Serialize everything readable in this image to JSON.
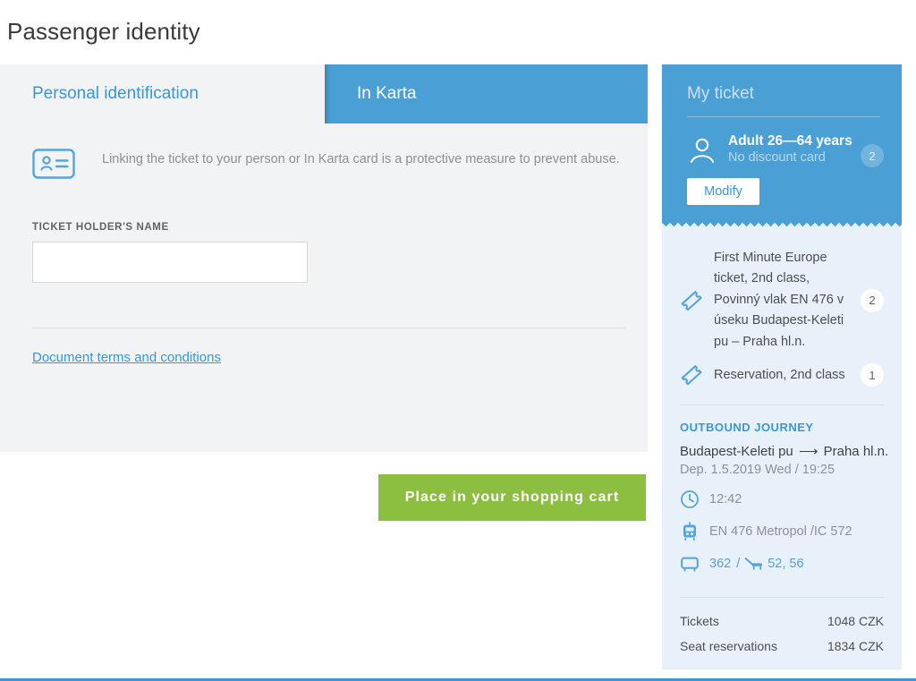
{
  "page": {
    "title": "Passenger identity"
  },
  "tabs": [
    {
      "label": "Personal identification",
      "active": false
    },
    {
      "label": "In Karta",
      "active": true
    }
  ],
  "form": {
    "notice_icon": "id-card-icon",
    "notice": "Linking the ticket to your person or In Karta card is a protective measure to prevent abuse.",
    "name_label": "TICKET HOLDER'S NAME",
    "name_value": "",
    "name_placeholder": "",
    "terms_link": "Document terms and conditions",
    "submit_label": "Place in your shopping cart",
    "submit_color": "#8cbf3f"
  },
  "sidebar": {
    "title": "My ticket",
    "passenger": {
      "icon": "person-icon",
      "title": "Adult 26—64 years",
      "subtitle": "No discount card",
      "quantity": "2",
      "modify_label": "Modify"
    },
    "items": [
      {
        "icon": "ticket-icon",
        "text": "First Minute Europe ticket, 2nd class, Povinný vlak EN 476 v úseku Budapest-Keleti pu – Praha hl.n.",
        "quantity": "2"
      },
      {
        "icon": "ticket-icon",
        "text": "Reservation, 2nd class",
        "quantity": "1"
      }
    ],
    "journey": {
      "heading": "OUTBOUND JOURNEY",
      "from": "Budapest-Keleti pu",
      "arrow": "⟶",
      "to": "Praha hl.n.",
      "departure": "Dep. 1.5.2019 Wed / 19:25",
      "duration_icon": "clock-icon",
      "duration": "12:42",
      "train_icon": "train-icon",
      "train": "EN 476 Metropol /IC 572",
      "coach_icon": "coach-icon",
      "coach": "362",
      "separator": "/",
      "seat_icon": "seat-icon",
      "seats": "52, 56"
    },
    "prices": [
      {
        "label": "Tickets",
        "value": "1048 CZK"
      },
      {
        "label": "Seat reservations",
        "value": "1834 CZK"
      }
    ]
  }
}
